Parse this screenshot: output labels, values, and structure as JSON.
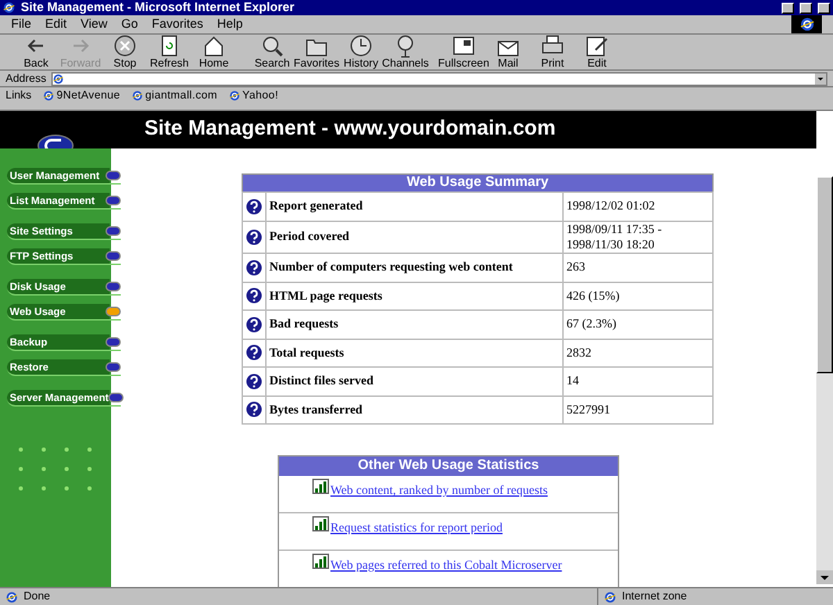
{
  "window": {
    "title": "Site Management - Microsoft Internet Explorer"
  },
  "menu": [
    "File",
    "Edit",
    "View",
    "Go",
    "Favorites",
    "Help"
  ],
  "toolbar": [
    {
      "label": "Back",
      "kind": "back",
      "disabled": false
    },
    {
      "label": "Forward",
      "kind": "forward",
      "disabled": true
    },
    {
      "label": "Stop",
      "kind": "stop",
      "disabled": false
    },
    {
      "label": "Refresh",
      "kind": "refresh",
      "disabled": false
    },
    {
      "label": "Home",
      "kind": "home",
      "disabled": false
    },
    {
      "label": "Search",
      "kind": "search",
      "disabled": false
    },
    {
      "label": "Favorites",
      "kind": "favorites",
      "disabled": false
    },
    {
      "label": "History",
      "kind": "history",
      "disabled": false
    },
    {
      "label": "Channels",
      "kind": "channels",
      "disabled": false
    },
    {
      "label": "Fullscreen",
      "kind": "fullscreen",
      "disabled": false
    },
    {
      "label": "Mail",
      "kind": "mail",
      "disabled": false
    },
    {
      "label": "Print",
      "kind": "print",
      "disabled": false
    },
    {
      "label": "Edit",
      "kind": "edit",
      "disabled": false
    }
  ],
  "address": {
    "label": "Address"
  },
  "links": {
    "label": "Links",
    "items": [
      "9NetAvenue",
      "giantmall.com",
      "Yahoo!"
    ]
  },
  "page": {
    "header": "Site Management - www.yourdomain.com",
    "sidebar": [
      [
        {
          "label": "User Management",
          "selected": false
        },
        {
          "label": "List Management",
          "selected": false
        }
      ],
      [
        {
          "label": "Site Settings",
          "selected": false
        },
        {
          "label": "FTP Settings",
          "selected": false
        }
      ],
      [
        {
          "label": "Disk Usage",
          "selected": false
        },
        {
          "label": "Web Usage",
          "selected": true
        }
      ],
      [
        {
          "label": "Backup",
          "selected": false
        },
        {
          "label": "Restore",
          "selected": false
        }
      ],
      [
        {
          "label": "Server Management",
          "selected": false
        }
      ]
    ],
    "summary": {
      "title": "Web Usage Summary",
      "rows": [
        {
          "label": "Report generated",
          "value": "1998/12/02 01:02"
        },
        {
          "label": "Period covered",
          "value": "1998/09/11 17:35 - 1998/11/30 18:20"
        },
        {
          "label": "Number of computers requesting web content",
          "value": "263"
        },
        {
          "label": "HTML page requests",
          "value": "426 (15%)"
        },
        {
          "label": "Bad requests",
          "value": "67 (2.3%)"
        },
        {
          "label": "Total requests",
          "value": "2832"
        },
        {
          "label": "Distinct files served",
          "value": "14"
        },
        {
          "label": "Bytes transferred",
          "value": "5227991"
        }
      ]
    },
    "other": {
      "title": "Other Web Usage Statistics",
      "links": [
        "Web content, ranked by number of requests",
        "Request statistics for report period",
        "Web pages referred to this Cobalt Microserver"
      ]
    }
  },
  "status_bar": {
    "text": "Done",
    "zone": "Internet zone"
  }
}
